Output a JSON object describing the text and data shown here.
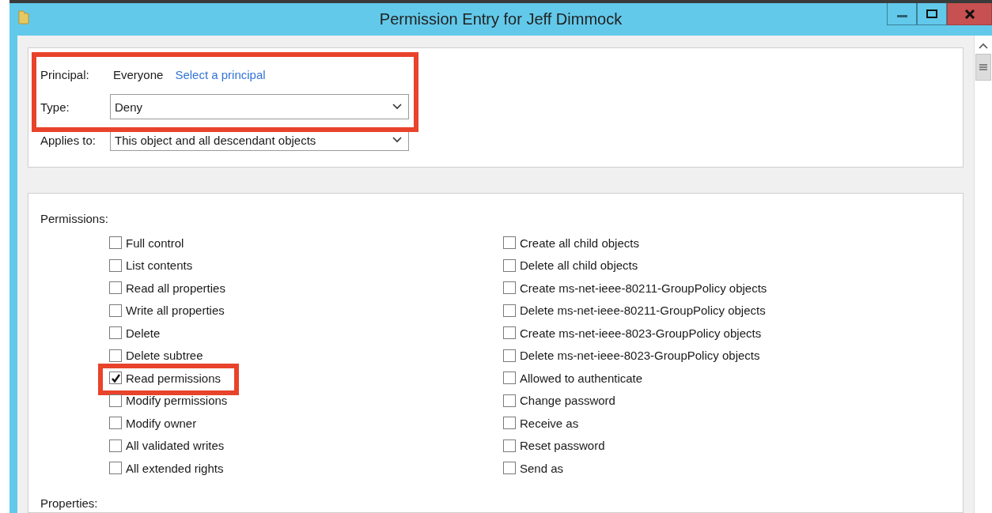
{
  "window": {
    "title": "Permission Entry for Jeff Dimmock"
  },
  "principal_section": {
    "highlighted": true,
    "principal_label": "Principal:",
    "principal": "Everyone",
    "select_link": "Select a principal",
    "type_label": "Type:",
    "type_value": "Deny"
  },
  "applies_to": {
    "label": "Applies to:",
    "value": "This object and all descendant objects"
  },
  "permissions": {
    "label": "Permissions:",
    "columns": [
      [
        {
          "label": "Full control",
          "checked": false,
          "highlighted": false
        },
        {
          "label": "List contents",
          "checked": false,
          "highlighted": false
        },
        {
          "label": "Read all properties",
          "checked": false,
          "highlighted": false
        },
        {
          "label": "Write all properties",
          "checked": false,
          "highlighted": false
        },
        {
          "label": "Delete",
          "checked": false,
          "highlighted": false
        },
        {
          "label": "Delete subtree",
          "checked": false,
          "highlighted": false
        },
        {
          "label": "Read permissions",
          "checked": true,
          "highlighted": true
        },
        {
          "label": "Modify permissions",
          "checked": false,
          "highlighted": false
        },
        {
          "label": "Modify owner",
          "checked": false,
          "highlighted": false
        },
        {
          "label": "All validated writes",
          "checked": false,
          "highlighted": false
        },
        {
          "label": "All extended rights",
          "checked": false,
          "highlighted": false
        }
      ],
      [
        {
          "label": "Create all child objects",
          "checked": false,
          "highlighted": false
        },
        {
          "label": "Delete all child objects",
          "checked": false,
          "highlighted": false
        },
        {
          "label": "Create ms-net-ieee-80211-GroupPolicy objects",
          "checked": false,
          "highlighted": false
        },
        {
          "label": "Delete ms-net-ieee-80211-GroupPolicy objects",
          "checked": false,
          "highlighted": false
        },
        {
          "label": "Create ms-net-ieee-8023-GroupPolicy objects",
          "checked": false,
          "highlighted": false
        },
        {
          "label": "Delete ms-net-ieee-8023-GroupPolicy objects",
          "checked": false,
          "highlighted": false
        },
        {
          "label": "Allowed to authenticate",
          "checked": false,
          "highlighted": false
        },
        {
          "label": "Change password",
          "checked": false,
          "highlighted": false
        },
        {
          "label": "Receive as",
          "checked": false,
          "highlighted": false
        },
        {
          "label": "Reset password",
          "checked": false,
          "highlighted": false
        },
        {
          "label": "Send as",
          "checked": false,
          "highlighted": false
        }
      ]
    ]
  },
  "properties": {
    "label": "Properties:"
  }
}
